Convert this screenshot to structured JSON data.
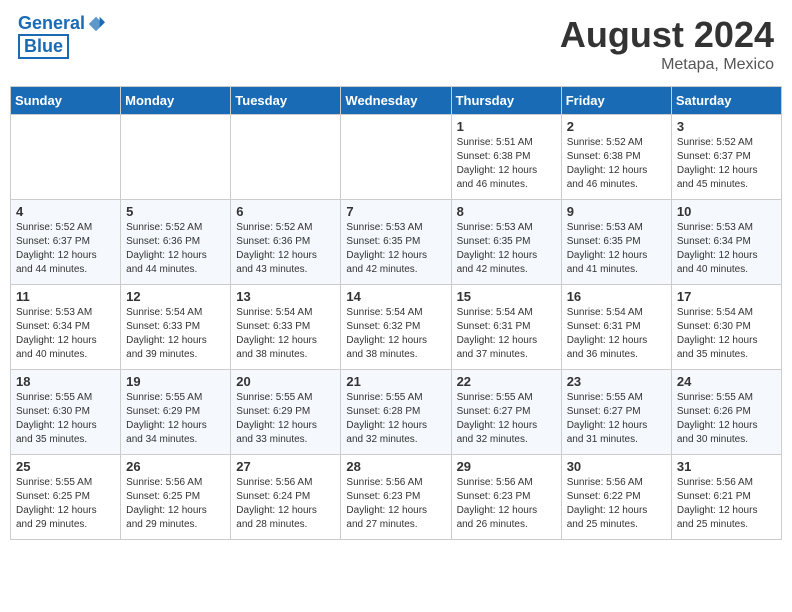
{
  "header": {
    "logo_line1": "General",
    "logo_line2": "Blue",
    "month": "August 2024",
    "location": "Metapa, Mexico"
  },
  "weekdays": [
    "Sunday",
    "Monday",
    "Tuesday",
    "Wednesday",
    "Thursday",
    "Friday",
    "Saturday"
  ],
  "weeks": [
    [
      {
        "day": "",
        "info": ""
      },
      {
        "day": "",
        "info": ""
      },
      {
        "day": "",
        "info": ""
      },
      {
        "day": "",
        "info": ""
      },
      {
        "day": "1",
        "info": "Sunrise: 5:51 AM\nSunset: 6:38 PM\nDaylight: 12 hours\nand 46 minutes."
      },
      {
        "day": "2",
        "info": "Sunrise: 5:52 AM\nSunset: 6:38 PM\nDaylight: 12 hours\nand 46 minutes."
      },
      {
        "day": "3",
        "info": "Sunrise: 5:52 AM\nSunset: 6:37 PM\nDaylight: 12 hours\nand 45 minutes."
      }
    ],
    [
      {
        "day": "4",
        "info": "Sunrise: 5:52 AM\nSunset: 6:37 PM\nDaylight: 12 hours\nand 44 minutes."
      },
      {
        "day": "5",
        "info": "Sunrise: 5:52 AM\nSunset: 6:36 PM\nDaylight: 12 hours\nand 44 minutes."
      },
      {
        "day": "6",
        "info": "Sunrise: 5:52 AM\nSunset: 6:36 PM\nDaylight: 12 hours\nand 43 minutes."
      },
      {
        "day": "7",
        "info": "Sunrise: 5:53 AM\nSunset: 6:35 PM\nDaylight: 12 hours\nand 42 minutes."
      },
      {
        "day": "8",
        "info": "Sunrise: 5:53 AM\nSunset: 6:35 PM\nDaylight: 12 hours\nand 42 minutes."
      },
      {
        "day": "9",
        "info": "Sunrise: 5:53 AM\nSunset: 6:35 PM\nDaylight: 12 hours\nand 41 minutes."
      },
      {
        "day": "10",
        "info": "Sunrise: 5:53 AM\nSunset: 6:34 PM\nDaylight: 12 hours\nand 40 minutes."
      }
    ],
    [
      {
        "day": "11",
        "info": "Sunrise: 5:53 AM\nSunset: 6:34 PM\nDaylight: 12 hours\nand 40 minutes."
      },
      {
        "day": "12",
        "info": "Sunrise: 5:54 AM\nSunset: 6:33 PM\nDaylight: 12 hours\nand 39 minutes."
      },
      {
        "day": "13",
        "info": "Sunrise: 5:54 AM\nSunset: 6:33 PM\nDaylight: 12 hours\nand 38 minutes."
      },
      {
        "day": "14",
        "info": "Sunrise: 5:54 AM\nSunset: 6:32 PM\nDaylight: 12 hours\nand 38 minutes."
      },
      {
        "day": "15",
        "info": "Sunrise: 5:54 AM\nSunset: 6:31 PM\nDaylight: 12 hours\nand 37 minutes."
      },
      {
        "day": "16",
        "info": "Sunrise: 5:54 AM\nSunset: 6:31 PM\nDaylight: 12 hours\nand 36 minutes."
      },
      {
        "day": "17",
        "info": "Sunrise: 5:54 AM\nSunset: 6:30 PM\nDaylight: 12 hours\nand 35 minutes."
      }
    ],
    [
      {
        "day": "18",
        "info": "Sunrise: 5:55 AM\nSunset: 6:30 PM\nDaylight: 12 hours\nand 35 minutes."
      },
      {
        "day": "19",
        "info": "Sunrise: 5:55 AM\nSunset: 6:29 PM\nDaylight: 12 hours\nand 34 minutes."
      },
      {
        "day": "20",
        "info": "Sunrise: 5:55 AM\nSunset: 6:29 PM\nDaylight: 12 hours\nand 33 minutes."
      },
      {
        "day": "21",
        "info": "Sunrise: 5:55 AM\nSunset: 6:28 PM\nDaylight: 12 hours\nand 32 minutes."
      },
      {
        "day": "22",
        "info": "Sunrise: 5:55 AM\nSunset: 6:27 PM\nDaylight: 12 hours\nand 32 minutes."
      },
      {
        "day": "23",
        "info": "Sunrise: 5:55 AM\nSunset: 6:27 PM\nDaylight: 12 hours\nand 31 minutes."
      },
      {
        "day": "24",
        "info": "Sunrise: 5:55 AM\nSunset: 6:26 PM\nDaylight: 12 hours\nand 30 minutes."
      }
    ],
    [
      {
        "day": "25",
        "info": "Sunrise: 5:55 AM\nSunset: 6:25 PM\nDaylight: 12 hours\nand 29 minutes."
      },
      {
        "day": "26",
        "info": "Sunrise: 5:56 AM\nSunset: 6:25 PM\nDaylight: 12 hours\nand 29 minutes."
      },
      {
        "day": "27",
        "info": "Sunrise: 5:56 AM\nSunset: 6:24 PM\nDaylight: 12 hours\nand 28 minutes."
      },
      {
        "day": "28",
        "info": "Sunrise: 5:56 AM\nSunset: 6:23 PM\nDaylight: 12 hours\nand 27 minutes."
      },
      {
        "day": "29",
        "info": "Sunrise: 5:56 AM\nSunset: 6:23 PM\nDaylight: 12 hours\nand 26 minutes."
      },
      {
        "day": "30",
        "info": "Sunrise: 5:56 AM\nSunset: 6:22 PM\nDaylight: 12 hours\nand 25 minutes."
      },
      {
        "day": "31",
        "info": "Sunrise: 5:56 AM\nSunset: 6:21 PM\nDaylight: 12 hours\nand 25 minutes."
      }
    ]
  ]
}
